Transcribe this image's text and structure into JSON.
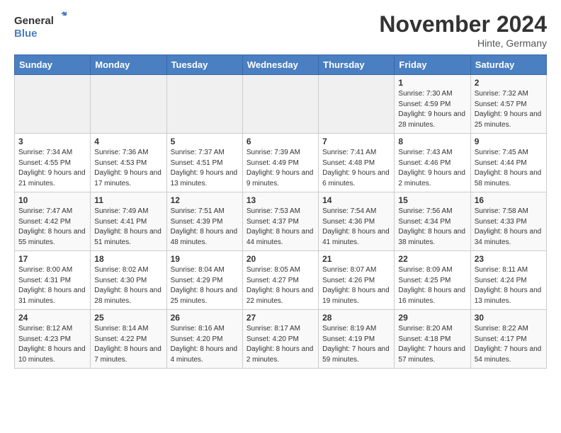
{
  "logo": {
    "line1": "General",
    "line2": "Blue"
  },
  "title": "November 2024",
  "subtitle": "Hinte, Germany",
  "days_of_week": [
    "Sunday",
    "Monday",
    "Tuesday",
    "Wednesday",
    "Thursday",
    "Friday",
    "Saturday"
  ],
  "weeks": [
    [
      {
        "day": "",
        "info": ""
      },
      {
        "day": "",
        "info": ""
      },
      {
        "day": "",
        "info": ""
      },
      {
        "day": "",
        "info": ""
      },
      {
        "day": "",
        "info": ""
      },
      {
        "day": "1",
        "info": "Sunrise: 7:30 AM\nSunset: 4:59 PM\nDaylight: 9 hours and 28 minutes."
      },
      {
        "day": "2",
        "info": "Sunrise: 7:32 AM\nSunset: 4:57 PM\nDaylight: 9 hours and 25 minutes."
      }
    ],
    [
      {
        "day": "3",
        "info": "Sunrise: 7:34 AM\nSunset: 4:55 PM\nDaylight: 9 hours and 21 minutes."
      },
      {
        "day": "4",
        "info": "Sunrise: 7:36 AM\nSunset: 4:53 PM\nDaylight: 9 hours and 17 minutes."
      },
      {
        "day": "5",
        "info": "Sunrise: 7:37 AM\nSunset: 4:51 PM\nDaylight: 9 hours and 13 minutes."
      },
      {
        "day": "6",
        "info": "Sunrise: 7:39 AM\nSunset: 4:49 PM\nDaylight: 9 hours and 9 minutes."
      },
      {
        "day": "7",
        "info": "Sunrise: 7:41 AM\nSunset: 4:48 PM\nDaylight: 9 hours and 6 minutes."
      },
      {
        "day": "8",
        "info": "Sunrise: 7:43 AM\nSunset: 4:46 PM\nDaylight: 9 hours and 2 minutes."
      },
      {
        "day": "9",
        "info": "Sunrise: 7:45 AM\nSunset: 4:44 PM\nDaylight: 8 hours and 58 minutes."
      }
    ],
    [
      {
        "day": "10",
        "info": "Sunrise: 7:47 AM\nSunset: 4:42 PM\nDaylight: 8 hours and 55 minutes."
      },
      {
        "day": "11",
        "info": "Sunrise: 7:49 AM\nSunset: 4:41 PM\nDaylight: 8 hours and 51 minutes."
      },
      {
        "day": "12",
        "info": "Sunrise: 7:51 AM\nSunset: 4:39 PM\nDaylight: 8 hours and 48 minutes."
      },
      {
        "day": "13",
        "info": "Sunrise: 7:53 AM\nSunset: 4:37 PM\nDaylight: 8 hours and 44 minutes."
      },
      {
        "day": "14",
        "info": "Sunrise: 7:54 AM\nSunset: 4:36 PM\nDaylight: 8 hours and 41 minutes."
      },
      {
        "day": "15",
        "info": "Sunrise: 7:56 AM\nSunset: 4:34 PM\nDaylight: 8 hours and 38 minutes."
      },
      {
        "day": "16",
        "info": "Sunrise: 7:58 AM\nSunset: 4:33 PM\nDaylight: 8 hours and 34 minutes."
      }
    ],
    [
      {
        "day": "17",
        "info": "Sunrise: 8:00 AM\nSunset: 4:31 PM\nDaylight: 8 hours and 31 minutes."
      },
      {
        "day": "18",
        "info": "Sunrise: 8:02 AM\nSunset: 4:30 PM\nDaylight: 8 hours and 28 minutes."
      },
      {
        "day": "19",
        "info": "Sunrise: 8:04 AM\nSunset: 4:29 PM\nDaylight: 8 hours and 25 minutes."
      },
      {
        "day": "20",
        "info": "Sunrise: 8:05 AM\nSunset: 4:27 PM\nDaylight: 8 hours and 22 minutes."
      },
      {
        "day": "21",
        "info": "Sunrise: 8:07 AM\nSunset: 4:26 PM\nDaylight: 8 hours and 19 minutes."
      },
      {
        "day": "22",
        "info": "Sunrise: 8:09 AM\nSunset: 4:25 PM\nDaylight: 8 hours and 16 minutes."
      },
      {
        "day": "23",
        "info": "Sunrise: 8:11 AM\nSunset: 4:24 PM\nDaylight: 8 hours and 13 minutes."
      }
    ],
    [
      {
        "day": "24",
        "info": "Sunrise: 8:12 AM\nSunset: 4:23 PM\nDaylight: 8 hours and 10 minutes."
      },
      {
        "day": "25",
        "info": "Sunrise: 8:14 AM\nSunset: 4:22 PM\nDaylight: 8 hours and 7 minutes."
      },
      {
        "day": "26",
        "info": "Sunrise: 8:16 AM\nSunset: 4:20 PM\nDaylight: 8 hours and 4 minutes."
      },
      {
        "day": "27",
        "info": "Sunrise: 8:17 AM\nSunset: 4:20 PM\nDaylight: 8 hours and 2 minutes."
      },
      {
        "day": "28",
        "info": "Sunrise: 8:19 AM\nSunset: 4:19 PM\nDaylight: 7 hours and 59 minutes."
      },
      {
        "day": "29",
        "info": "Sunrise: 8:20 AM\nSunset: 4:18 PM\nDaylight: 7 hours and 57 minutes."
      },
      {
        "day": "30",
        "info": "Sunrise: 8:22 AM\nSunset: 4:17 PM\nDaylight: 7 hours and 54 minutes."
      }
    ]
  ]
}
